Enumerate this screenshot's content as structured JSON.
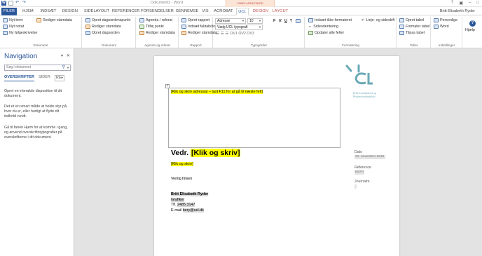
{
  "window": {
    "title": "Dokument2 - Word",
    "context_tab_group": "TABELVÆRKTØJER",
    "user": "Britt Elisabeth Ryder"
  },
  "tabs": [
    {
      "label": "FILER"
    },
    {
      "label": "HJEM"
    },
    {
      "label": "INDSÆT"
    },
    {
      "label": "DESIGN"
    },
    {
      "label": "SIDELAYOUT"
    },
    {
      "label": "REFERENCER"
    },
    {
      "label": "FORSENDELSER"
    },
    {
      "label": "GENNEMSE"
    },
    {
      "label": "VIS"
    },
    {
      "label": "ACROBAT"
    },
    {
      "label": "UCL"
    },
    {
      "label": "DESIGN"
    },
    {
      "label": "LAYOUT"
    }
  ],
  "ribbon": {
    "dokument": {
      "label": "Dokument",
      "items": [
        "Nyt brev",
        "Nyt notat",
        "Ny følgeskrivelse",
        "Rediger stamdata"
      ]
    },
    "dokument2": {
      "label": "Dokument",
      "items": [
        "Opret dagsordenspunkt",
        "Rediger stamdata",
        "Opret dagsorden"
      ]
    },
    "agenda": {
      "label": "Agenda og referat",
      "items": [
        "Agenda / referat",
        "Tilføj punkt",
        "Rediger stamdata"
      ]
    },
    "rapport": {
      "label": "Rapport",
      "items": [
        "Opret rapport",
        "Indsæt faktaboks",
        "Rediger stamdata"
      ]
    },
    "typografier": {
      "label": "Typografier",
      "style_box": "Adresse",
      "size_box": "10",
      "style_select": "Vælg UCL typografi",
      "bold": "F",
      "italic": "K",
      "underline": "U",
      "levels": "OV1 OV2 OV3"
    },
    "formatering": {
      "label": "Formatering",
      "items": [
        "Indsæt ikke-formateret",
        "Linje- og sideskift",
        "Sideorientering",
        "Opdater alle felter"
      ]
    },
    "tabel": {
      "label": "Tabel",
      "items": [
        "Opret tabel",
        "Formater tabel",
        "Tilpas tabel"
      ]
    },
    "indstillinger": {
      "label": "Indstillinger",
      "items": [
        "Personlige",
        "Word"
      ]
    },
    "hjaelp": {
      "label": "Hjælp"
    }
  },
  "navigation": {
    "title": "Navigation",
    "search_placeholder": "Søg i dokument",
    "tabs": [
      "OVERSKRIFTER",
      "SIDER",
      "RE"
    ],
    "paragraphs": [
      "Opret en interaktiv disposition til dit dokument.",
      "Det er en smart måde at holde styr på, hvor du er, eller hurtigt at flytte dit indhold rundt.",
      "Gå til fanen Hjem for at komme i gang, og anvend overskriftstypografier på overskrifterne i dit dokument."
    ]
  },
  "document": {
    "address_placeholder": "[Klik og skriv adressat – tast F11 for at gå til næste felt]",
    "logo_subtitle": [
      "Erhvervsakademi og",
      "Professionshøjskole"
    ],
    "vedr_label": "Vedr.",
    "vedr_value": "[Klik og skriv]",
    "body_placeholder": "[Klik og skriv]",
    "greeting": "Venlig hilsen",
    "sender": {
      "name": "Britt Elisabeth Ryder",
      "role": "Grafiker",
      "phone_label": "Tlf.",
      "phone": "2485 3147",
      "email_label": "E-mail",
      "email": "bery@ucl.dk"
    },
    "side": {
      "date_label": "Dato",
      "date": "22. november 2016",
      "reference_label": "Reference",
      "reference": "BERY",
      "journal_label": "Journalnr."
    }
  },
  "colors": {
    "accent": "#2b579a",
    "highlight": "#ffff00",
    "logo": "#6aa9b6"
  }
}
